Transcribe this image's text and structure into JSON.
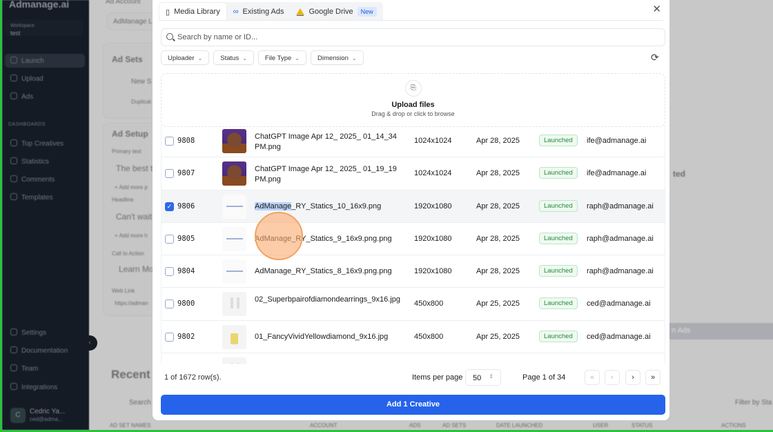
{
  "sidebar": {
    "logo": "Admanage.ai",
    "workspace_label": "Workspace",
    "workspace": "test",
    "items": [
      {
        "label": "Launch"
      },
      {
        "label": "Upload"
      },
      {
        "label": "Ads"
      }
    ],
    "section": "DASHBOARDS",
    "dash_items": [
      {
        "label": "Top Creatives"
      },
      {
        "label": "Statistics"
      },
      {
        "label": "Comments"
      },
      {
        "label": "Templates"
      }
    ],
    "bottom_items": [
      {
        "label": "Settings"
      },
      {
        "label": "Documentation"
      },
      {
        "label": "Team"
      },
      {
        "label": "Integrations"
      }
    ],
    "user": {
      "initial": "C",
      "name": "Cedric Ya...",
      "email": "ced@adma..."
    }
  },
  "background": {
    "ad_account": "Ad Account",
    "account_value": "AdManage L",
    "ad_sets": "Ad Sets",
    "new_set": "New S",
    "duplicate": "Duplicat",
    "ad_setup": "Ad Setup",
    "primary_text": "Primary text",
    "primary_value": "The best t",
    "add_more_1": "+ Add more p",
    "headline": "Headline",
    "headline_value": "Can't wait",
    "add_more_2": "+ Add more h",
    "cta": "Call to Action",
    "cta_value": "Learn Mo",
    "web_link": "Web Link",
    "web_value": "https://adman",
    "recent": "Recent A",
    "search": "Search",
    "partial": "ted",
    "launch_ads": "n Ads",
    "filter_status": "Filter by Sta",
    "columns": [
      "AD SET NAMES",
      "ACCOUNT",
      "ADS",
      "AD SETS",
      "DATE LAUNCHED",
      "USER",
      "STATUS",
      "ACTIONS"
    ]
  },
  "modal": {
    "tabs": [
      {
        "label": "Media Library",
        "icon": "media-library-icon"
      },
      {
        "label": "Existing Ads",
        "icon": "meta-icon"
      },
      {
        "label": "Google Drive",
        "icon": "google-drive-icon",
        "badge": "New"
      }
    ],
    "search_placeholder": "Search by name or ID...",
    "filters": [
      {
        "label": "Uploader"
      },
      {
        "label": "Status"
      },
      {
        "label": "File Type"
      },
      {
        "label": "Dimension"
      }
    ],
    "upload": {
      "title": "Upload files",
      "subtitle": "Drag & drop or click to browse"
    },
    "rows": [
      {
        "id": "9808",
        "name": "ChatGPT Image Apr 12_ 2025_ 01_14_34 PM.png",
        "dimension": "1024x1024",
        "date": "Apr 28, 2025",
        "status": "Launched",
        "uploader": "ife@admanage.ai",
        "checked": false
      },
      {
        "id": "9807",
        "name": "ChatGPT Image Apr 12_ 2025_ 01_19_19 PM.png",
        "dimension": "1024x1024",
        "date": "Apr 28, 2025",
        "status": "Launched",
        "uploader": "ife@admanage.ai",
        "checked": false
      },
      {
        "id": "9806",
        "name_highlight": "AdManage",
        "name": "_RY_Statics_10_16x9.png",
        "dimension": "1920x1080",
        "date": "Apr 28, 2025",
        "status": "Launched",
        "uploader": "raph@admanage.ai",
        "checked": true
      },
      {
        "id": "9805",
        "name": "AdManage_RY_Statics_9_16x9.png.png",
        "dimension": "1920x1080",
        "date": "Apr 28, 2025",
        "status": "Launched",
        "uploader": "raph@admanage.ai",
        "checked": false
      },
      {
        "id": "9804",
        "name": "AdManage_RY_Statics_8_16x9.png.png",
        "dimension": "1920x1080",
        "date": "Apr 28, 2025",
        "status": "Launched",
        "uploader": "raph@admanage.ai",
        "checked": false
      },
      {
        "id": "9800",
        "name": "02_Superbpairofdiamondearrings_9x16.jpg",
        "dimension": "450x800",
        "date": "Apr 25, 2025",
        "status": "Launched",
        "uploader": "ced@admanage.ai",
        "checked": false
      },
      {
        "id": "9802",
        "name": "01_FancyVividYellowdiamond_9x16.jpg",
        "dimension": "450x800",
        "date": "Apr 25, 2025",
        "status": "Launched",
        "uploader": "ced@admanage.ai",
        "checked": false
      }
    ],
    "footer": {
      "selected": "1 of 1672 row(s).",
      "items_per_page_label": "Items per page",
      "items_per_page": "50",
      "page": "Page 1 of 34"
    },
    "add_button": "Add 1 Creative",
    "colors": {
      "primary": "#2563eb",
      "launched": "#26883e"
    }
  }
}
